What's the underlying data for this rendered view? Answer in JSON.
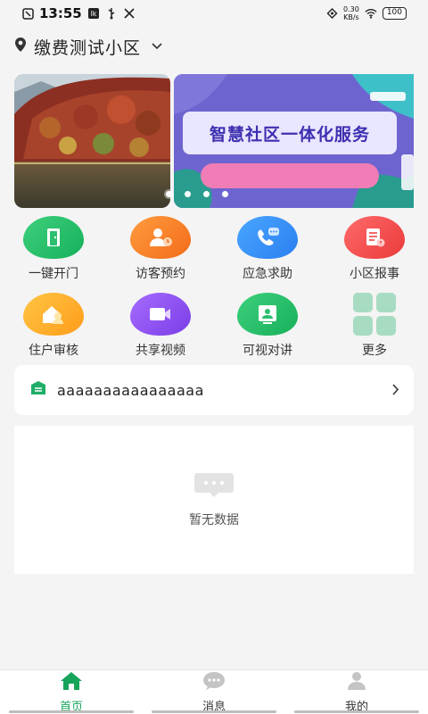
{
  "status_bar": {
    "time": "13:55",
    "speed_top": "0.30",
    "speed_bottom": "KB/s",
    "battery": "100"
  },
  "header": {
    "community_name": "缴费测试小区"
  },
  "banner": {
    "card_title": "智慧社区一体化服务",
    "dots_count": 4
  },
  "services": [
    {
      "label": "一键开门",
      "icon": "door-icon"
    },
    {
      "label": "访客预约",
      "icon": "visitor-icon"
    },
    {
      "label": "应急求助",
      "icon": "phone-chat-icon"
    },
    {
      "label": "小区报事",
      "icon": "report-icon"
    },
    {
      "label": "住户审核",
      "icon": "resident-audit-icon"
    },
    {
      "label": "共享视频",
      "icon": "video-icon"
    },
    {
      "label": "可视对讲",
      "icon": "intercom-icon"
    },
    {
      "label": "更多",
      "icon": "more-grid-icon"
    }
  ],
  "notice": {
    "text": "aaaaaaaaaaaaaaaa"
  },
  "empty_state": {
    "message": "暂无数据"
  },
  "tabbar": {
    "tabs": [
      {
        "label": "首页",
        "icon": "home-icon",
        "active": true
      },
      {
        "label": "消息",
        "icon": "message-icon",
        "active": false
      },
      {
        "label": "我的",
        "icon": "profile-icon",
        "active": false
      }
    ]
  },
  "colors": {
    "accent": "#16a45a",
    "background": "#f4f4f4"
  }
}
